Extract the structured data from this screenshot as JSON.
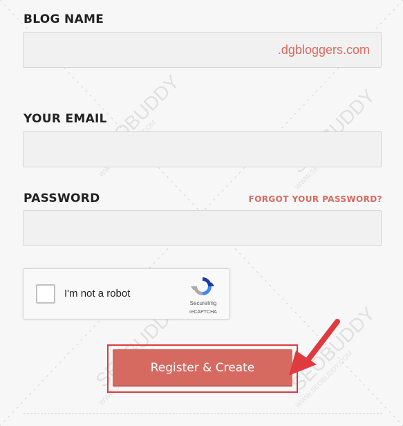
{
  "form": {
    "blog_name_label": "BLOG NAME",
    "blog_name_value": "",
    "blog_name_suffix": ".dgbloggers.com",
    "email_label": "YOUR EMAIL",
    "email_value": "",
    "password_label": "PASSWORD",
    "password_value": "",
    "forgot_link": "FORGOT YOUR PASSWORD?",
    "submit_label": "Register & Create"
  },
  "captcha": {
    "label": "I'm not a robot",
    "brand": "SecureImg",
    "sub": "reCAPTCHA",
    "checked": false
  },
  "watermark": {
    "text": "SEOBUDDY",
    "url": "WWW.SEOBUDDY.COM"
  },
  "colors": {
    "accent": "#d9685d",
    "button": "#d66a61",
    "highlight": "#e0393e"
  },
  "icons": {
    "annotation": "arrow-icon",
    "captcha_logo": "recaptcha-logo-icon"
  }
}
